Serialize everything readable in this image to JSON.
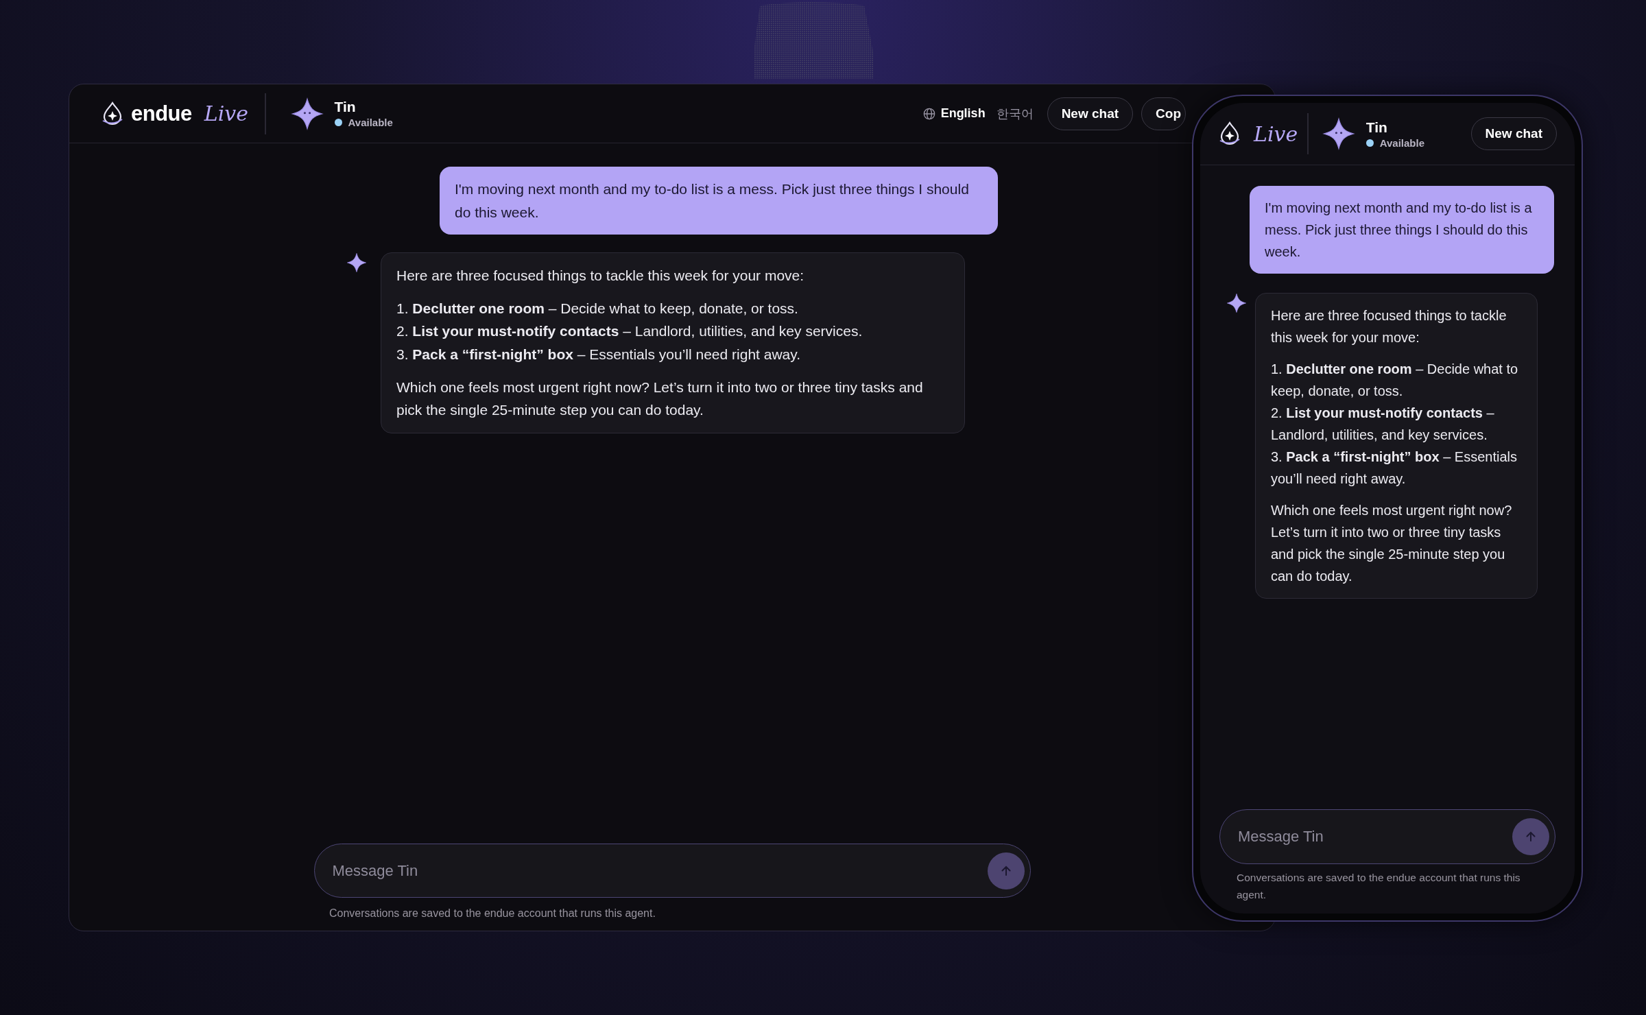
{
  "desktop": {
    "brand": {
      "name": "endue",
      "tag": "Live"
    },
    "agent": {
      "name": "Tin",
      "status": "Available",
      "online": true
    },
    "languages": [
      {
        "label": "English",
        "selected": true
      },
      {
        "label": "한국어",
        "selected": false
      }
    ],
    "buttons": [
      "New chat",
      "Cop"
    ],
    "messages": [
      {
        "kind": "user",
        "text": "I'm moving next month and my to-do list is a mess. Pick just three things I should do this week."
      },
      {
        "kind": "assistant",
        "blocks": [
          {
            "kind": "paragraph",
            "text": "Here are three focused things to tackle this week for your move:"
          },
          {
            "kind": "list",
            "items": [
              "1. **Declutter one room** – Decide what to keep, donate, or toss.",
              "2. **List your must-notify contacts** – Landlord, utilities, and key services.",
              "3. **Pack a “first-night” box** – Essentials you’ll need right away."
            ]
          },
          {
            "kind": "paragraph",
            "text": "Which one feels most urgent right now? Let’s turn it into two or three tiny tasks and pick the single 25-minute step you can do today."
          }
        ]
      }
    ],
    "composer": {
      "placeholder": "Message Tin"
    },
    "footer": "Conversations are saved to the endue account that runs this agent."
  },
  "phone": {
    "brand": {
      "tag": "Live"
    },
    "agent": {
      "name": "Tin",
      "status": "Available",
      "online": true
    },
    "buttons": [
      "New chat"
    ],
    "messages": [
      {
        "kind": "user",
        "text": "I'm moving next month and my to-do list is a mess. Pick just three things I should do this week."
      },
      {
        "kind": "assistant",
        "blocks": [
          {
            "kind": "paragraph",
            "text": "Here are three focused things to tackle this week for your move:"
          },
          {
            "kind": "list",
            "items": [
              "1. **Declutter one room** – Decide what to keep, donate, or toss.",
              "2. **List your must-notify contacts** – Landlord, utilities, and key services.",
              "3. **Pack a “first-night” box** – Essentials you’ll need right away."
            ]
          },
          {
            "kind": "paragraph",
            "text": "Which one feels most urgent right now? Let’s turn it into two or three tiny tasks and pick the single 25-minute step you can do today."
          }
        ]
      }
    ],
    "composer": {
      "placeholder": "Message Tin"
    },
    "footer": "Conversations are saved to the endue account that runs this agent."
  }
}
